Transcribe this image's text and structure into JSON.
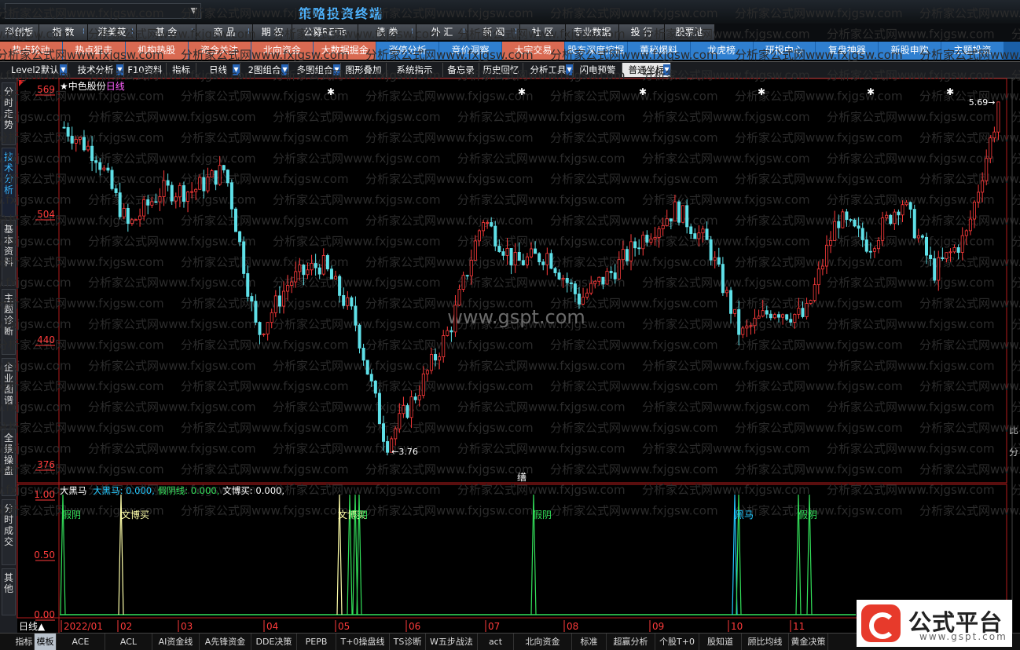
{
  "window": {
    "title": "策略投资终端"
  },
  "menubar": [
    {
      "label": "科创板",
      "dot": false
    },
    {
      "label": "指 数",
      "dot": true
    },
    {
      "label": "港美英",
      "dot": true
    },
    {
      "label": "基 金",
      "dot": true
    },
    {
      "label": "商 品",
      "dot": true
    },
    {
      "label": "期 权",
      "dot": false
    },
    {
      "label": "公募REITs",
      "dot": false
    },
    {
      "label": "债 券",
      "dot": true
    },
    {
      "label": "外 汇",
      "dot": true
    },
    {
      "label": "新 闻",
      "dot": true
    },
    {
      "label": "社 区",
      "dot": false
    },
    {
      "label": "专业数据",
      "dot": false
    },
    {
      "label": "投 行",
      "dot": false
    },
    {
      "label": "股票池",
      "dot": false
    }
  ],
  "navbar": [
    {
      "label": "热点轮动",
      "style": "red"
    },
    {
      "label": "热点狙击",
      "style": "red"
    },
    {
      "label": "机构热股",
      "style": "red"
    },
    {
      "label": "资金关注",
      "style": "red"
    },
    {
      "label": "北向资金",
      "style": "red"
    },
    {
      "label": "大数据掘金",
      "style": "red"
    },
    {
      "label": "涨停分析",
      "style": "blue"
    },
    {
      "label": "竞价洞察",
      "style": "blue"
    },
    {
      "label": "大宗交易",
      "style": "red"
    },
    {
      "label": "股东深度挖掘",
      "style": "blue"
    },
    {
      "label": "董秘爆料",
      "style": "blue"
    },
    {
      "label": "龙虎榜",
      "style": "blue"
    },
    {
      "label": "研报中心",
      "style": "blue"
    },
    {
      "label": "复盘神器",
      "style": "blue"
    },
    {
      "label": "新股申购",
      "style": "blue"
    },
    {
      "label": "主题投资",
      "style": "blue"
    }
  ],
  "toolbar": [
    {
      "label": "Level2默认",
      "dd": true,
      "lit": false
    },
    {
      "label": "技术分析",
      "dd": true,
      "lit": false
    },
    {
      "label": "F10资料",
      "dd": false,
      "lit": false
    },
    {
      "label": "指标",
      "dd": false,
      "lit": false
    },
    {
      "label": "日线",
      "dd": true,
      "lit": false
    },
    {
      "label": "2图组合",
      "dd": true,
      "lit": false
    },
    {
      "label": "多图组合",
      "dd": true,
      "lit": false
    },
    {
      "label": "图形叠加",
      "dd": false,
      "lit": false
    },
    {
      "label": "系统指示",
      "dd": false,
      "lit": false
    },
    {
      "label": "备忘录",
      "dd": false,
      "lit": false
    },
    {
      "label": "历史回忆",
      "dd": false,
      "lit": false
    },
    {
      "label": "分析工具",
      "dd": true,
      "lit": false
    },
    {
      "label": "闪电预警",
      "dd": false,
      "lit": false
    },
    {
      "label": "普通坐标",
      "dd": true,
      "lit": true
    }
  ],
  "sidetabs": [
    {
      "label": "分时走势",
      "active": false
    },
    {
      "label": "技术分析",
      "active": true
    },
    {
      "label": "基本资料",
      "active": false
    },
    {
      "label": "主题诊断",
      "active": false
    },
    {
      "label": "企业图谱",
      "active": false
    },
    {
      "label": "全景操盘",
      "active": false
    },
    {
      "label": "分时成交",
      "active": false
    },
    {
      "label": "其他",
      "active": false
    }
  ],
  "stock": {
    "star": "★",
    "name": "中色股份",
    "period": "日线"
  },
  "watermark": {
    "repeat": "分析家公式网www.fxjgsw.com",
    "center": "www.gspt.com"
  },
  "price_axis": {
    "ticks": [
      "569",
      "504",
      "440",
      "376"
    ]
  },
  "price_marks": {
    "low": "←3.76",
    "high": "5.69→",
    "marker": "缮"
  },
  "indicator": {
    "legend_name": "大黑马",
    "series": [
      {
        "label": "大黑马: 0.000,",
        "color": "#22c8ff"
      },
      {
        "label": "假阴线: 0.000,",
        "color": "#33e05a"
      },
      {
        "label": "文博买: 0.000,",
        "color": "#ffffff"
      }
    ],
    "axis_ticks": [
      "1.00",
      "0.50",
      "0.00"
    ],
    "signal_labels": [
      {
        "text": "假阴",
        "color": "#33e05a"
      },
      {
        "text": "文博买",
        "color": "#ffffaa"
      },
      {
        "text": "文博买",
        "color": "#ffffaa"
      },
      {
        "text": "假阴",
        "color": "#33e05a"
      },
      {
        "text": "假阴",
        "color": "#33e05a"
      },
      {
        "text": "黑马",
        "color": "#22c8ff"
      },
      {
        "text": "假阴",
        "color": "#33e05a"
      }
    ]
  },
  "time_axis": {
    "period_label": "日线▲",
    "months": [
      "2022/01",
      "02",
      "03",
      "04",
      "05",
      "06",
      "07",
      "08",
      "09",
      "10",
      "11"
    ]
  },
  "bottom_tabs": [
    {
      "label": "指标",
      "lit": false
    },
    {
      "label": "模板",
      "lit": true
    },
    {
      "label": "ACE",
      "lit": false
    },
    {
      "label": "ACL",
      "lit": false
    },
    {
      "label": "AI资金线",
      "lit": false
    },
    {
      "label": "A先锋资金",
      "lit": false
    },
    {
      "label": "DDE决策",
      "lit": false
    },
    {
      "label": "PEPB",
      "lit": false
    },
    {
      "label": "T+0操盘线",
      "lit": false
    },
    {
      "label": "TS诊断",
      "lit": false
    },
    {
      "label": "W五步战法",
      "lit": false
    },
    {
      "label": "act",
      "lit": false
    },
    {
      "label": "北向资金",
      "lit": false
    },
    {
      "label": "标准",
      "lit": false
    },
    {
      "label": "超赢分析",
      "lit": false
    },
    {
      "label": "个股T+0",
      "lit": false
    },
    {
      "label": "股知道",
      "lit": false
    },
    {
      "label": "顾比均线",
      "lit": false
    },
    {
      "label": "黄金决策",
      "lit": false
    }
  ],
  "right_edge_text": [
    "比",
    "分"
  ],
  "brand": {
    "name": "公式平台",
    "url": "www.gspt.com"
  },
  "colors": {
    "up": "#ff3b3b",
    "down": "#5fe0e8",
    "frame": "#b31b1b",
    "accent": "#38b7ff"
  },
  "chart_data": {
    "type": "candlestick",
    "period": "daily",
    "y_range": [
      3.6,
      5.75
    ],
    "high": 5.69,
    "low": 3.76,
    "close_path": [
      {
        "x": "2022/01",
        "y": 5.55
      },
      {
        "x": "2022/01",
        "y": 5.4
      },
      {
        "x": "2022/02",
        "y": 5.0
      },
      {
        "x": "2022/02",
        "y": 5.2
      },
      {
        "x": "2022/03",
        "y": 5.2
      },
      {
        "x": "2022/03",
        "y": 5.32
      },
      {
        "x": "2022/03",
        "y": 4.4
      },
      {
        "x": "2022/04",
        "y": 4.7
      },
      {
        "x": "2022/04",
        "y": 4.8
      },
      {
        "x": "2022/04",
        "y": 4.5
      },
      {
        "x": "2022/05",
        "y": 3.8
      },
      {
        "x": "2022/05",
        "y": 4.1
      },
      {
        "x": "2022/05",
        "y": 4.45
      },
      {
        "x": "2022/06",
        "y": 5.05
      },
      {
        "x": "2022/06",
        "y": 4.8
      },
      {
        "x": "2022/07",
        "y": 4.85
      },
      {
        "x": "2022/07",
        "y": 4.6
      },
      {
        "x": "2022/08",
        "y": 4.75
      },
      {
        "x": "2022/08",
        "y": 4.95
      },
      {
        "x": "2022/09",
        "y": 5.1
      },
      {
        "x": "2022/09",
        "y": 4.9
      },
      {
        "x": "2022/10",
        "y": 4.4
      },
      {
        "x": "2022/10",
        "y": 4.55
      },
      {
        "x": "2022/10",
        "y": 4.5
      },
      {
        "x": "2022/11",
        "y": 5.05
      },
      {
        "x": "2022/11",
        "y": 4.9
      },
      {
        "x": "2022/11",
        "y": 5.15
      },
      {
        "x": "2022/12",
        "y": 4.75
      },
      {
        "x": "2022/12",
        "y": 4.95
      },
      {
        "x": "2022/12",
        "y": 5.65
      }
    ]
  }
}
